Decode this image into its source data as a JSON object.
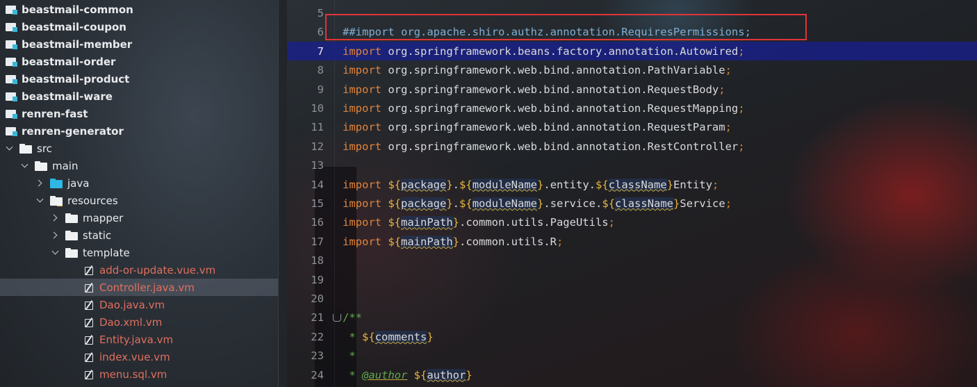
{
  "tree": {
    "items": [
      {
        "label": "beastmail-common",
        "kind": "module",
        "level": 0,
        "arrow": "",
        "bold": true
      },
      {
        "label": "beastmail-coupon",
        "kind": "module",
        "level": 0,
        "arrow": "",
        "bold": true
      },
      {
        "label": "beastmail-member",
        "kind": "module",
        "level": 0,
        "arrow": "",
        "bold": true
      },
      {
        "label": "beastmail-order",
        "kind": "module",
        "level": 0,
        "arrow": "",
        "bold": true
      },
      {
        "label": "beastmail-product",
        "kind": "module",
        "level": 0,
        "arrow": "",
        "bold": true
      },
      {
        "label": "beastmail-ware",
        "kind": "module",
        "level": 0,
        "arrow": "",
        "bold": true
      },
      {
        "label": "renren-fast",
        "kind": "module",
        "level": 0,
        "arrow": "",
        "bold": true
      },
      {
        "label": "renren-generator",
        "kind": "module",
        "level": 0,
        "arrow": "",
        "bold": true
      },
      {
        "label": "src",
        "kind": "folder",
        "level": 1,
        "arrow": "down"
      },
      {
        "label": "main",
        "kind": "folder",
        "level": 2,
        "arrow": "down"
      },
      {
        "label": "java",
        "kind": "java-folder",
        "level": 3,
        "arrow": "right"
      },
      {
        "label": "resources",
        "kind": "resources-folder",
        "level": 3,
        "arrow": "down"
      },
      {
        "label": "mapper",
        "kind": "folder",
        "level": 4,
        "arrow": "right"
      },
      {
        "label": "static",
        "kind": "folder",
        "level": 4,
        "arrow": "right"
      },
      {
        "label": "template",
        "kind": "folder",
        "level": 4,
        "arrow": "down"
      },
      {
        "label": "add-or-update.vue.vm",
        "kind": "file",
        "level": 5,
        "arrow": ""
      },
      {
        "label": "Controller.java.vm",
        "kind": "file",
        "level": 5,
        "arrow": "",
        "selected": true
      },
      {
        "label": "Dao.java.vm",
        "kind": "file",
        "level": 5,
        "arrow": ""
      },
      {
        "label": "Dao.xml.vm",
        "kind": "file",
        "level": 5,
        "arrow": ""
      },
      {
        "label": "Entity.java.vm",
        "kind": "file",
        "level": 5,
        "arrow": ""
      },
      {
        "label": "index.vue.vm",
        "kind": "file",
        "level": 5,
        "arrow": ""
      },
      {
        "label": "menu.sql.vm",
        "kind": "file",
        "level": 5,
        "arrow": ""
      }
    ]
  },
  "editor": {
    "current_line": 7,
    "lines": [
      {
        "n": "5",
        "tokens": []
      },
      {
        "n": "6",
        "tokens": [
          {
            "t": "##import org.apache.shiro.authz.annotation.RequiresPermissions;",
            "c": "cm"
          }
        ]
      },
      {
        "n": "7",
        "tokens": [
          {
            "t": "import ",
            "c": "kw"
          },
          {
            "t": "org.springframework.beans.factory.annotation.Autowired",
            "c": ""
          },
          {
            "t": ";",
            "c": "semi"
          }
        ]
      },
      {
        "n": "8",
        "tokens": [
          {
            "t": "import ",
            "c": "kw"
          },
          {
            "t": "org.springframework.web.bind.annotation.PathVariable",
            "c": ""
          },
          {
            "t": ";",
            "c": "semi"
          }
        ]
      },
      {
        "n": "9",
        "tokens": [
          {
            "t": "import ",
            "c": "kw"
          },
          {
            "t": "org.springframework.web.bind.annotation.RequestBody",
            "c": ""
          },
          {
            "t": ";",
            "c": "semi"
          }
        ]
      },
      {
        "n": "10",
        "tokens": [
          {
            "t": "import ",
            "c": "kw"
          },
          {
            "t": "org.springframework.web.bind.annotation.RequestMapping",
            "c": ""
          },
          {
            "t": ";",
            "c": "semi"
          }
        ]
      },
      {
        "n": "11",
        "tokens": [
          {
            "t": "import ",
            "c": "kw"
          },
          {
            "t": "org.springframework.web.bind.annotation.RequestParam",
            "c": ""
          },
          {
            "t": ";",
            "c": "semi"
          }
        ]
      },
      {
        "n": "12",
        "tokens": [
          {
            "t": "import ",
            "c": "kw"
          },
          {
            "t": "org.springframework.web.bind.annotation.RestController",
            "c": ""
          },
          {
            "t": ";",
            "c": "semi"
          }
        ]
      },
      {
        "n": "13",
        "tokens": []
      },
      {
        "n": "14",
        "tokens": [
          {
            "t": "import ",
            "c": "kw"
          },
          {
            "t": "${",
            "c": "tk"
          },
          {
            "t": "package",
            "c": "var"
          },
          {
            "t": "}",
            "c": "tk"
          },
          {
            "t": ".",
            "c": ""
          },
          {
            "t": "${",
            "c": "tk"
          },
          {
            "t": "moduleName",
            "c": "var"
          },
          {
            "t": "}",
            "c": "tk"
          },
          {
            "t": ".entity.",
            "c": ""
          },
          {
            "t": "${",
            "c": "tk"
          },
          {
            "t": "className",
            "c": "var"
          },
          {
            "t": "}",
            "c": "tk"
          },
          {
            "t": "Entity",
            "c": ""
          },
          {
            "t": ";",
            "c": "semi"
          }
        ]
      },
      {
        "n": "15",
        "tokens": [
          {
            "t": "import ",
            "c": "kw"
          },
          {
            "t": "${",
            "c": "tk"
          },
          {
            "t": "package",
            "c": "var"
          },
          {
            "t": "}",
            "c": "tk"
          },
          {
            "t": ".",
            "c": ""
          },
          {
            "t": "${",
            "c": "tk"
          },
          {
            "t": "moduleName",
            "c": "var"
          },
          {
            "t": "}",
            "c": "tk"
          },
          {
            "t": ".service.",
            "c": ""
          },
          {
            "t": "${",
            "c": "tk"
          },
          {
            "t": "className",
            "c": "var"
          },
          {
            "t": "}",
            "c": "tk"
          },
          {
            "t": "Service",
            "c": ""
          },
          {
            "t": ";",
            "c": "semi"
          }
        ]
      },
      {
        "n": "16",
        "tokens": [
          {
            "t": "import ",
            "c": "kw"
          },
          {
            "t": "${",
            "c": "tk"
          },
          {
            "t": "mainPath",
            "c": "var"
          },
          {
            "t": "}",
            "c": "tk"
          },
          {
            "t": ".common.utils.PageUtils",
            "c": ""
          },
          {
            "t": ";",
            "c": "semi"
          }
        ]
      },
      {
        "n": "17",
        "tokens": [
          {
            "t": "import ",
            "c": "kw"
          },
          {
            "t": "${",
            "c": "tk"
          },
          {
            "t": "mainPath",
            "c": "var"
          },
          {
            "t": "}",
            "c": "tk"
          },
          {
            "t": ".common.utils.R",
            "c": ""
          },
          {
            "t": ";",
            "c": "semi"
          }
        ]
      },
      {
        "n": "18",
        "tokens": []
      },
      {
        "n": "19",
        "tokens": []
      },
      {
        "n": "20",
        "tokens": []
      },
      {
        "n": "21",
        "fold": true,
        "tokens": [
          {
            "t": "/**",
            "c": "doc"
          }
        ]
      },
      {
        "n": "22",
        "tokens": [
          {
            "t": " * ",
            "c": "doc"
          },
          {
            "t": "${",
            "c": "tk"
          },
          {
            "t": "comments",
            "c": "var"
          },
          {
            "t": "}",
            "c": "tk"
          }
        ]
      },
      {
        "n": "23",
        "tokens": [
          {
            "t": " *",
            "c": "doc"
          }
        ]
      },
      {
        "n": "24",
        "tokens": [
          {
            "t": " * ",
            "c": "doc"
          },
          {
            "t": "@author",
            "c": "tag"
          },
          {
            "t": " ",
            "c": ""
          },
          {
            "t": "${",
            "c": "tk"
          },
          {
            "t": "author",
            "c": "var"
          },
          {
            "t": "}",
            "c": "tk"
          }
        ]
      }
    ]
  }
}
